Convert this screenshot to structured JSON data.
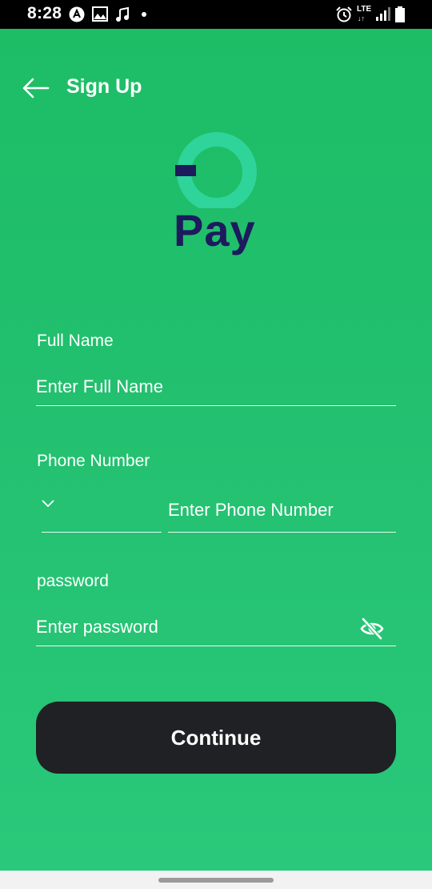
{
  "status_bar": {
    "time": "8:28",
    "network": "LTE",
    "icons": [
      "accessibility-icon",
      "gallery-icon",
      "music-icon",
      "dot-icon",
      "alarm-icon",
      "lte-icon",
      "signal-icon",
      "battery-icon"
    ]
  },
  "header": {
    "title": "Sign Up",
    "back_icon": "arrow-left-icon"
  },
  "logo": {
    "text": "Pay",
    "ring_color": "#2fd49a",
    "text_color": "#1d1a5e"
  },
  "form": {
    "full_name": {
      "label": "Full Name",
      "placeholder": "Enter Full Name",
      "value": ""
    },
    "phone": {
      "label": "Phone Number",
      "country_code": "",
      "placeholder": "Enter Phone Number",
      "value": ""
    },
    "password": {
      "label": "password",
      "placeholder": "Enter password",
      "value": "",
      "toggle_icon": "eye-off-icon"
    }
  },
  "continue_button": {
    "label": "Continue"
  },
  "colors": {
    "background": "#1dbd66",
    "button": "#202124",
    "text": "#ffffff"
  }
}
